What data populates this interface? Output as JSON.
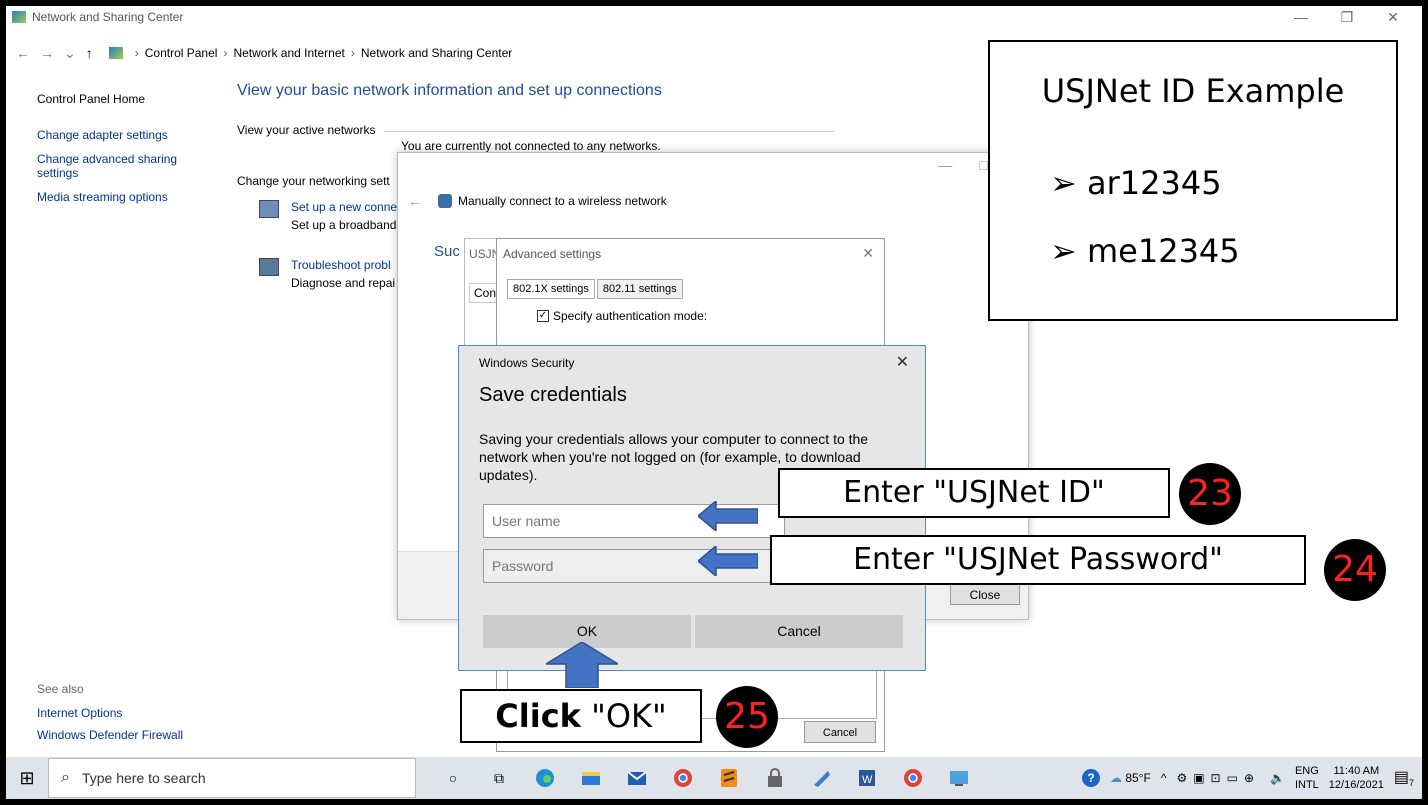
{
  "window": {
    "title": "Network and Sharing Center",
    "controls": {
      "minimize": "—",
      "restore": "❐",
      "close": "✕"
    }
  },
  "address_bar": {
    "nav": {
      "back": "←",
      "forward": "→",
      "recent": "⌄",
      "up": "↑"
    },
    "crumbs": [
      "Control Panel",
      "Network and Internet",
      "Network and Sharing Center"
    ],
    "sep": "›"
  },
  "left_nav": {
    "home": "Control Panel Home",
    "links": [
      "Change adapter settings",
      "Change advanced sharing settings",
      "Media streaming options"
    ]
  },
  "see_also": {
    "label": "See also",
    "links": [
      "Internet Options",
      "Windows Defender Firewall"
    ]
  },
  "main": {
    "title": "View your basic network information and set up connections",
    "active_networks_label": "View your active networks",
    "not_connected": "You are currently not connected to any networks.",
    "change_label": "Change your networking sett",
    "tasks": [
      {
        "title": "Set up a new conne",
        "desc": "Set up a broadband"
      },
      {
        "title": "Troubleshoot probl",
        "desc": "Diagnose and repai"
      }
    ]
  },
  "wireless_dialog": {
    "back": "←",
    "header": "Manually connect to a wireless network",
    "success": "Suc",
    "controls": {
      "minimize": "—",
      "restore": "□"
    },
    "close_button": "Close"
  },
  "usjn_dialog": {
    "title": "USJN",
    "tab": "Con"
  },
  "advanced_dialog": {
    "title": "Advanced settings",
    "close": "✕",
    "tabs": [
      "802.1X settings",
      "802.11 settings"
    ],
    "checkbox_label": "Specify authentication mode:",
    "checkbox_mark": "✓",
    "cancel": "Cancel"
  },
  "security_dialog": {
    "title": "Windows Security",
    "close": "✕",
    "heading": "Save credentials",
    "description": "Saving your credentials allows your computer to connect to the network when you're not logged on (for example, to download updates).",
    "username_placeholder": "User name",
    "password_placeholder": "Password",
    "ok": "OK",
    "cancel": "Cancel"
  },
  "annotations": {
    "id_example": {
      "heading": "USJNet ID Example",
      "bullet": "➢",
      "items": [
        "ar12345",
        "me12345"
      ]
    },
    "callout_username": "Enter \"USJNet ID\"",
    "callout_password": "Enter \"USJNet Password\"",
    "callout_ok_bold": "Click",
    "callout_ok_rest": " \"OK\"",
    "steps": [
      "23",
      "24",
      "25"
    ]
  },
  "taskbar": {
    "start_icon": "windows-logo",
    "start_glyph": "⊞",
    "search_glyph": "⌕",
    "search_placeholder": "Type here to search",
    "cortana_glyph": "○",
    "taskview_glyph": "⧉",
    "apps": [
      "edge",
      "file-explorer",
      "mail",
      "chrome",
      "sublime",
      "lock-app",
      "app",
      "word",
      "chrome-profile",
      "remote-desktop"
    ],
    "help_glyph": "?",
    "weather": "85°F",
    "tray_arrow": "^",
    "lang": "ENG",
    "layout": "INTL",
    "time": "11:40 AM",
    "date": "12/16/2021",
    "notif_count": "7"
  }
}
